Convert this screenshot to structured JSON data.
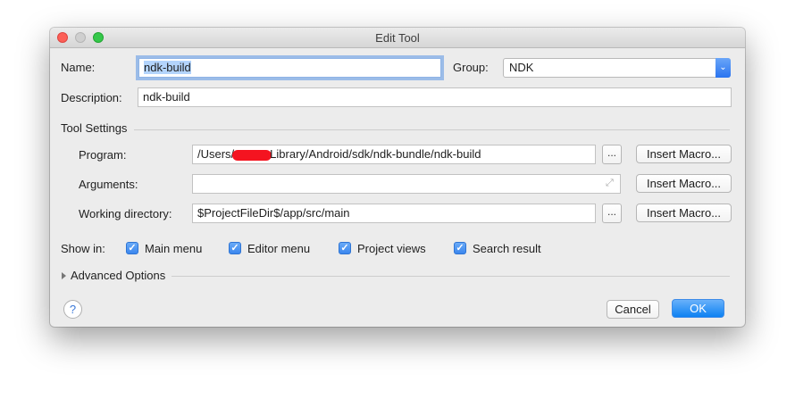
{
  "window": {
    "title": "Edit Tool"
  },
  "form": {
    "name_label": "Name:",
    "name_value": "ndk-build",
    "group_label": "Group:",
    "group_value": "NDK",
    "description_label": "Description:",
    "description_value": "ndk-build"
  },
  "tool_settings": {
    "section_label": "Tool Settings",
    "program_label": "Program:",
    "program_value_prefix": "/Users/",
    "program_value_suffix": "Library/Android/sdk/ndk-bundle/ndk-build",
    "arguments_label": "Arguments:",
    "arguments_value": "",
    "working_dir_label": "Working directory:",
    "working_dir_value": "$ProjectFileDir$/app/src/main",
    "browse_label": "...",
    "insert_macro_label": "Insert Macro..."
  },
  "show_in": {
    "label": "Show in:",
    "options": [
      {
        "label": "Main menu",
        "checked": true
      },
      {
        "label": "Editor menu",
        "checked": true
      },
      {
        "label": "Project views",
        "checked": true
      },
      {
        "label": "Search result",
        "checked": true
      }
    ]
  },
  "advanced": {
    "label": "Advanced Options"
  },
  "footer": {
    "help_label": "?",
    "cancel_label": "Cancel",
    "ok_label": "OK"
  },
  "icons": {
    "checkbox": "check-icon",
    "expand": "expand-arrows-icon",
    "disclosure": "disclosure-triangle-icon",
    "help": "help-icon"
  },
  "colors": {
    "accent": "#2a74f0",
    "redaction": "#f41420"
  }
}
